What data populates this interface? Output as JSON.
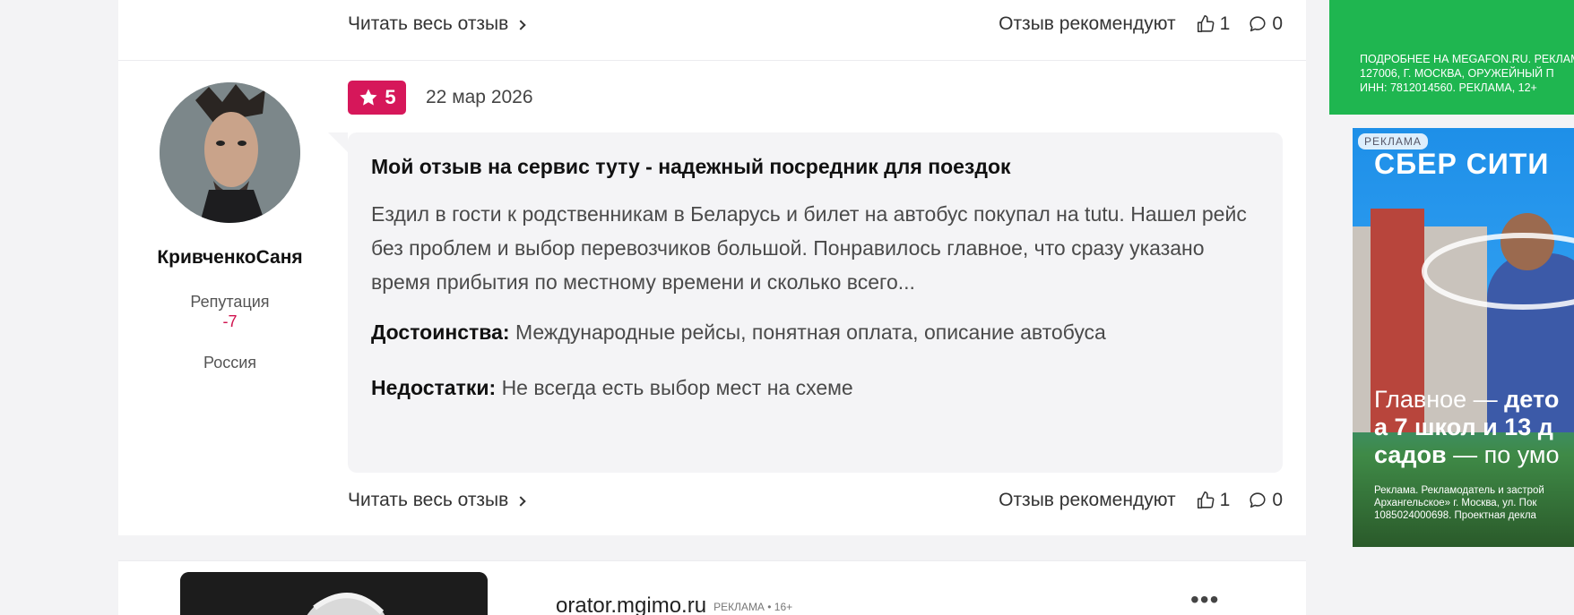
{
  "review_prev": {
    "read_more": "Читать весь отзыв",
    "recommend_label": "Отзыв рекомендуют",
    "likes": "1",
    "comments": "0"
  },
  "review": {
    "author": {
      "name": "КривченкоСаня",
      "reputation_label": "Репутация",
      "reputation_value": "-7",
      "country": "Россия"
    },
    "rating": "5",
    "date": "22 мар 2026",
    "title": "Мой отзыв на сервис туту - надежный посредник для поездок",
    "text": "Ездил в гости к родственникам в Беларусь и билет на автобус покупал на tutu. Нашел рейс без проблем и выбор перевозчиков большой. Понравилось главное, что сразу указано время прибытия по местному времени и сколько всего...",
    "pros_label": "Достоинства:",
    "pros": "Международные рейсы, понятная оплата, описание автобуса",
    "cons_label": "Недостатки:",
    "cons": "Не всегда есть выбор мест на схеме",
    "read_more": "Читать весь отзыв",
    "recommend_label": "Отзыв рекомендуют",
    "likes": "1",
    "comments": "0"
  },
  "ad_bottom": {
    "site": "orator.mgimo.ru",
    "tag": "РЕКЛАМА • 16+",
    "more": "•••"
  },
  "side_ad_top": {
    "line1": "ПОДРОБНЕЕ НА MEGAFON.RU. РЕКЛАМА",
    "line2": "127006, Г. МОСКВА, ОРУЖЕЙНЫЙ П",
    "line3": "ИНН: 7812014560. РЕКЛАМА, 12+",
    "color": "#1fb650"
  },
  "side_ad_main": {
    "label": "РЕКЛАМА",
    "brand": "СБЕР СИТИ",
    "headline_1a": "Главное — ",
    "headline_1b": "дето",
    "headline_2": "а 7 школ и 13 д",
    "headline_3a": "садов",
    "headline_3b": " — по умо",
    "small_1": "Реклама. Рекламодатель и застрой",
    "small_2": "Архангельское» г. Москва, ул. Пок",
    "small_3": "1085024000698. Проектная декла"
  },
  "colors": {
    "accent": "#d6175a",
    "reputation": "#d0134f"
  }
}
